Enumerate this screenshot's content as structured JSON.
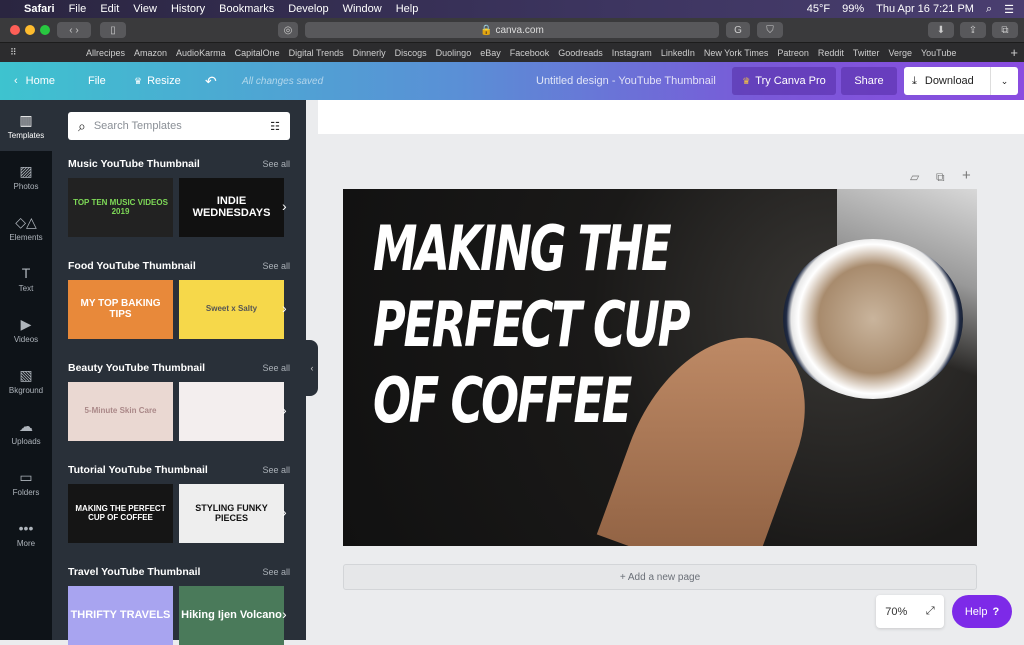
{
  "menubar": {
    "apple": "",
    "app": "Safari",
    "items": [
      "File",
      "Edit",
      "View",
      "History",
      "Bookmarks",
      "Develop",
      "Window",
      "Help"
    ],
    "weather": "45°F",
    "battery": "99%",
    "datetime": "Thu Apr 16  7:21 PM"
  },
  "safari": {
    "url": "canva.com",
    "bookmarks": [
      "Allrecipes",
      "Amazon",
      "AudioKarma",
      "CapitalOne",
      "Digital Trends",
      "Dinnerly",
      "Discogs",
      "Duolingo",
      "eBay",
      "Facebook",
      "Goodreads",
      "Instagram",
      "LinkedIn",
      "New York Times",
      "Patreon",
      "Reddit",
      "Twitter",
      "Verge",
      "YouTube"
    ]
  },
  "header": {
    "home": "Home",
    "file": "File",
    "resize": "Resize",
    "saved": "All changes saved",
    "doc_title": "Untitled design - YouTube Thumbnail",
    "try_pro": "Try Canva Pro",
    "share": "Share",
    "download": "Download"
  },
  "rail": [
    {
      "label": "Templates",
      "icon": "▥"
    },
    {
      "label": "Photos",
      "icon": "▨"
    },
    {
      "label": "Elements",
      "icon": "◇△"
    },
    {
      "label": "Text",
      "icon": "T"
    },
    {
      "label": "Videos",
      "icon": "▶"
    },
    {
      "label": "Bkground",
      "icon": "▧"
    },
    {
      "label": "Uploads",
      "icon": "☁"
    },
    {
      "label": "Folders",
      "icon": "▭"
    },
    {
      "label": "More",
      "icon": "•••"
    }
  ],
  "panel": {
    "search_placeholder": "Search Templates",
    "see_all": "See all",
    "sections": [
      {
        "title": "Music YouTube Thumbnail",
        "thumbs": [
          "TOP TEN MUSIC VIDEOS 2019",
          "INDIE WEDNESDAYS"
        ]
      },
      {
        "title": "Food YouTube Thumbnail",
        "thumbs": [
          "MY TOP BAKING TIPS",
          "Sweet x Salty"
        ]
      },
      {
        "title": "Beauty YouTube Thumbnail",
        "thumbs": [
          "5-Minute Skin Care",
          ""
        ]
      },
      {
        "title": "Tutorial YouTube Thumbnail",
        "thumbs": [
          "MAKING THE PERFECT CUP OF COFFEE",
          "STYLING FUNKY PIECES"
        ]
      },
      {
        "title": "Travel YouTube Thumbnail",
        "thumbs": [
          "THRIFTY TRAVELS",
          "Hiking Ijen Volcano"
        ]
      }
    ]
  },
  "design": {
    "lines": [
      "MAKING THE",
      "PERFECT CUP",
      "OF COFFEE"
    ]
  },
  "add_page": "+ Add a new page",
  "zoom": "70%",
  "help": "Help",
  "help_icon": "?"
}
